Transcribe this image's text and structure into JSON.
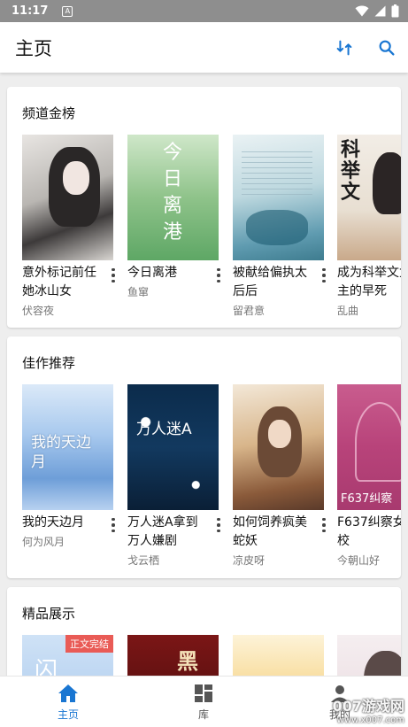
{
  "status_bar": {
    "time": "11:17",
    "notification_glyph": "A"
  },
  "app_bar": {
    "title": "主页",
    "icons": [
      "sort-icon",
      "search-icon"
    ]
  },
  "sections": [
    {
      "title": "频道金榜",
      "books": [
        {
          "title": "意外标记前任她冰山女",
          "author": "伏容夜",
          "cover_text": ""
        },
        {
          "title": "今日离港",
          "author": "鱼窜",
          "cover_text": "今日离港"
        },
        {
          "title": "被献给偏执太后后",
          "author": "留君意",
          "cover_text": ""
        },
        {
          "title": "成为科举文女主的早死",
          "author": "乱曲",
          "cover_text": "科举文"
        }
      ]
    },
    {
      "title": "佳作推荐",
      "books": [
        {
          "title": "我的天边月",
          "author": "何为风月",
          "cover_text": "我的天边月"
        },
        {
          "title": "万人迷A拿到万人嫌剧",
          "author": "戈云栖",
          "cover_text": "万人迷A"
        },
        {
          "title": "如何饲养疯美蛇妖",
          "author": "凉皮呀",
          "cover_text": ""
        },
        {
          "title": "F637纠察女校",
          "author": "今朝山好",
          "cover_text": "F637纠察"
        }
      ]
    },
    {
      "title": "精品展示",
      "books": [
        {
          "title": "",
          "author": "",
          "cover_text": "闪",
          "badge": "正文完结"
        },
        {
          "title": "",
          "author": "",
          "cover_text": "黑"
        },
        {
          "title": "",
          "author": "",
          "cover_text": ""
        },
        {
          "title": "",
          "author": "",
          "cover_text": ""
        }
      ]
    }
  ],
  "bottom_nav": [
    {
      "label": "主页",
      "icon": "home-icon",
      "active": true
    },
    {
      "label": "库",
      "icon": "library-icon",
      "active": false
    },
    {
      "label": "我的",
      "icon": "profile-icon",
      "active": false
    }
  ],
  "watermark": {
    "text": "007游戏网",
    "url": "www.x007.com"
  },
  "colors": {
    "accent": "#1976d2",
    "badge": "#e95b56",
    "status_bar": "#8e8e8e"
  }
}
